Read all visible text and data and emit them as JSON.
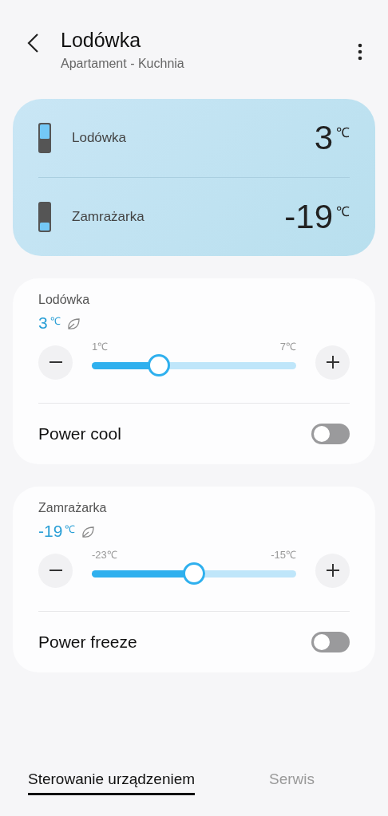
{
  "header": {
    "title": "Lodówka",
    "subtitle": "Apartament - Kuchnia"
  },
  "summary": [
    {
      "kind": "fridge",
      "name": "Lodówka",
      "value": "3",
      "unit": "℃"
    },
    {
      "kind": "freezer",
      "name": "Zamrażarka",
      "value": "-19",
      "unit": "℃"
    }
  ],
  "controls": [
    {
      "title": "Lodówka",
      "value": "3",
      "unit": "℃",
      "min_label": "1℃",
      "max_label": "7℃",
      "level": 0.33,
      "toggle_label": "Power cool",
      "on": false
    },
    {
      "title": "Zamrażarka",
      "value": "-19",
      "unit": "℃",
      "min_label": "-23℃",
      "max_label": "-15℃",
      "level": 0.5,
      "toggle_label": "Power freeze",
      "on": false
    }
  ],
  "tabs": [
    {
      "label": "Sterowanie urządzeniem",
      "selected": true
    },
    {
      "label": "Serwis",
      "selected": false
    }
  ]
}
